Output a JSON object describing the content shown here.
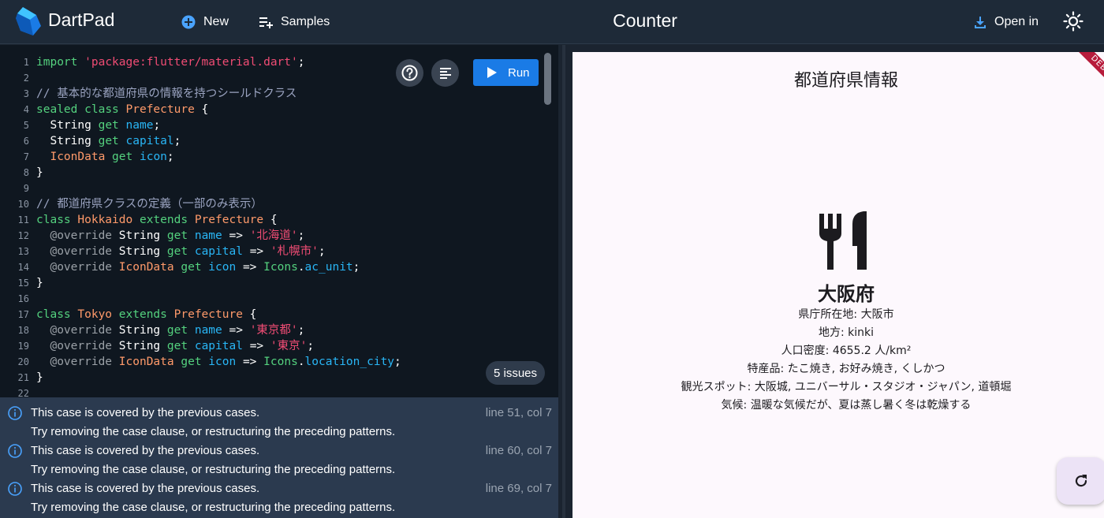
{
  "header": {
    "brand": "DartPad",
    "new_label": "New",
    "samples_label": "Samples",
    "title": "Counter",
    "open_in_label": "Open in"
  },
  "editor": {
    "line_numbers": [
      "1",
      "2",
      "3",
      "4",
      "5",
      "6",
      "7",
      "8",
      "9",
      "10",
      "11",
      "12",
      "13",
      "14",
      "15",
      "16",
      "17",
      "18",
      "19",
      "20",
      "21",
      "22"
    ],
    "code": {
      "l1_kw": "import",
      "l1_str": "'package:flutter/material.dart'",
      "l1_end": ";",
      "l3_comment": "// 基本的な都道府県の情報を持つシールドクラス",
      "l4_sealed": "sealed",
      "l4_class": "class",
      "l4_type": "Prefecture",
      "l4_brace": " {",
      "l5_type": "String",
      "l5_get": "get",
      "l5_name": "name",
      "l5_end": ";",
      "l6_type": "String",
      "l6_get": "get",
      "l6_name": "capital",
      "l6_end": ";",
      "l7_type": "IconData",
      "l7_get": "get",
      "l7_name": "icon",
      "l7_end": ";",
      "l8": "}",
      "l10_comment": "// 都道府県クラスの定義（一部のみ表示）",
      "l11_class": "class",
      "l11_name": "Hokkaido",
      "l11_extends": "extends",
      "l11_super": "Prefecture",
      "l11_brace": " {",
      "l12_ann": "@override",
      "l12_type": "String",
      "l12_get": "get",
      "l12_field": "name",
      "l12_arrow": "=>",
      "l12_str": "'北海道'",
      "l12_end": ";",
      "l13_ann": "@override",
      "l13_type": "String",
      "l13_get": "get",
      "l13_field": "capital",
      "l13_arrow": "=>",
      "l13_str": "'札幌市'",
      "l13_end": ";",
      "l14_ann": "@override",
      "l14_type": "IconData",
      "l14_get": "get",
      "l14_field": "icon",
      "l14_arrow": "=>",
      "l14_icons": "Icons",
      "l14_dot": ".",
      "l14_val": "ac_unit",
      "l14_end": ";",
      "l15": "}",
      "l17_class": "class",
      "l17_name": "Tokyo",
      "l17_extends": "extends",
      "l17_super": "Prefecture",
      "l17_brace": " {",
      "l18_ann": "@override",
      "l18_type": "String",
      "l18_get": "get",
      "l18_field": "name",
      "l18_arrow": "=>",
      "l18_str": "'東京都'",
      "l18_end": ";",
      "l19_ann": "@override",
      "l19_type": "String",
      "l19_get": "get",
      "l19_field": "capital",
      "l19_arrow": "=>",
      "l19_str": "'東京'",
      "l19_end": ";",
      "l20_ann": "@override",
      "l20_type": "IconData",
      "l20_get": "get",
      "l20_field": "icon",
      "l20_arrow": "=>",
      "l20_icons": "Icons",
      "l20_dot": ".",
      "l20_val": "location_city",
      "l20_end": ";",
      "l21": "}"
    },
    "run_label": "Run",
    "issues_badge": "5 issues"
  },
  "problems": [
    {
      "message": "This case is covered by the previous cases.",
      "location": "line 51, col 7",
      "hint": "Try removing the case clause, or restructuring the preceding patterns."
    },
    {
      "message": "This case is covered by the previous cases.",
      "location": "line 60, col 7",
      "hint": "Try removing the case clause, or restructuring the preceding patterns."
    },
    {
      "message": "This case is covered by the previous cases.",
      "location": "line 69, col 7",
      "hint": "Try removing the case clause, or restructuring the preceding patterns."
    }
  ],
  "preview": {
    "app_title": "都道府県情報",
    "debug_ribbon": "DEBUG",
    "prefecture_name": "大阪府",
    "info_lines": [
      "県庁所在地: 大阪市",
      "地方: kinki",
      "人口密度: 4655.2 人/km²",
      "特産品: たこ焼き, お好み焼き, くしかつ",
      "観光スポット: 大阪城, ユニバーサル・スタジオ・ジャパン, 道頓堀",
      "気候: 温暖な気候だが、夏は蒸し暑く冬は乾燥する"
    ]
  },
  "colors": {
    "header_bg": "#1e2a38",
    "editor_bg": "#0f1720",
    "problems_bg": "#2b3a4f",
    "run_button": "#1a7be6",
    "keyword": "#54d17e",
    "string": "#f04c74",
    "type": "#ff9a6a",
    "field": "#29b6f6"
  },
  "icons": [
    "dartpad-logo-icon",
    "add-circle-icon",
    "playlist-add-icon",
    "download-icon",
    "sun-icon",
    "help-circle-icon",
    "format-icon",
    "play-icon",
    "info-icon",
    "restaurant-icon",
    "refresh-icon"
  ]
}
